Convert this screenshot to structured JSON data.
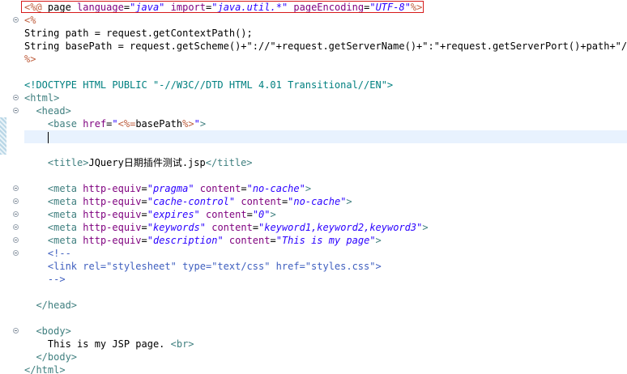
{
  "editor": {
    "lines": [
      [
        {
          "c": "jsp",
          "t": "<%@ "
        },
        {
          "c": "plain",
          "t": "page "
        },
        {
          "c": "attr",
          "t": "language"
        },
        {
          "c": "plain",
          "t": "="
        },
        {
          "c": "str",
          "t": "\"java\""
        },
        {
          "c": "plain",
          "t": " "
        },
        {
          "c": "attr",
          "t": "import"
        },
        {
          "c": "plain",
          "t": "="
        },
        {
          "c": "str",
          "t": "\"java.util.*\""
        },
        {
          "c": "plain",
          "t": " "
        },
        {
          "c": "attr",
          "t": "pageEncoding"
        },
        {
          "c": "plain",
          "t": "="
        },
        {
          "c": "str",
          "t": "\"UTF-8\""
        },
        {
          "c": "jsp",
          "t": "%>"
        }
      ],
      [
        {
          "c": "jsp",
          "t": "<%"
        }
      ],
      [
        {
          "c": "plain",
          "t": "String path = request.getContextPath();"
        }
      ],
      [
        {
          "c": "plain",
          "t": "String basePath = request.getScheme()+\"://\"+request.getServerName()+\":\"+request.getServerPort()+path+\"/\";"
        }
      ],
      [
        {
          "c": "jsp",
          "t": "%>"
        }
      ],
      [],
      [
        {
          "c": "doctype",
          "t": "<!DOCTYPE HTML PUBLIC \"-//W3C//DTD HTML 4.01 Transitional//EN\">"
        }
      ],
      [
        {
          "c": "tag",
          "t": "<html>"
        }
      ],
      [
        {
          "c": "plain",
          "t": "  "
        },
        {
          "c": "tag",
          "t": "<head>"
        }
      ],
      [
        {
          "c": "plain",
          "t": "    "
        },
        {
          "c": "tag",
          "t": "<base "
        },
        {
          "c": "attr",
          "t": "href"
        },
        {
          "c": "plain",
          "t": "="
        },
        {
          "c": "val",
          "t": "\""
        },
        {
          "c": "jsp",
          "t": "<%="
        },
        {
          "c": "plain",
          "t": "basePath"
        },
        {
          "c": "jsp",
          "t": "%>"
        },
        {
          "c": "val",
          "t": "\""
        },
        {
          "c": "tag",
          "t": ">"
        }
      ],
      [],
      [],
      [
        {
          "c": "plain",
          "t": "    "
        },
        {
          "c": "tag",
          "t": "<title>"
        },
        {
          "c": "text",
          "t": "JQuery日期插件测试.jsp"
        },
        {
          "c": "tag",
          "t": "</title>"
        }
      ],
      [],
      [
        {
          "c": "plain",
          "t": "    "
        },
        {
          "c": "tag",
          "t": "<meta "
        },
        {
          "c": "attr",
          "t": "http-equiv"
        },
        {
          "c": "plain",
          "t": "="
        },
        {
          "c": "str",
          "t": "\"pragma\""
        },
        {
          "c": "plain",
          "t": " "
        },
        {
          "c": "attr",
          "t": "content"
        },
        {
          "c": "plain",
          "t": "="
        },
        {
          "c": "str",
          "t": "\"no-cache\""
        },
        {
          "c": "tag",
          "t": ">"
        }
      ],
      [
        {
          "c": "plain",
          "t": "    "
        },
        {
          "c": "tag",
          "t": "<meta "
        },
        {
          "c": "attr",
          "t": "http-equiv"
        },
        {
          "c": "plain",
          "t": "="
        },
        {
          "c": "str",
          "t": "\"cache-control\""
        },
        {
          "c": "plain",
          "t": " "
        },
        {
          "c": "attr",
          "t": "content"
        },
        {
          "c": "plain",
          "t": "="
        },
        {
          "c": "str",
          "t": "\"no-cache\""
        },
        {
          "c": "tag",
          "t": ">"
        }
      ],
      [
        {
          "c": "plain",
          "t": "    "
        },
        {
          "c": "tag",
          "t": "<meta "
        },
        {
          "c": "attr",
          "t": "http-equiv"
        },
        {
          "c": "plain",
          "t": "="
        },
        {
          "c": "str",
          "t": "\"expires\""
        },
        {
          "c": "plain",
          "t": " "
        },
        {
          "c": "attr",
          "t": "content"
        },
        {
          "c": "plain",
          "t": "="
        },
        {
          "c": "str",
          "t": "\"0\""
        },
        {
          "c": "tag",
          "t": ">"
        }
      ],
      [
        {
          "c": "plain",
          "t": "    "
        },
        {
          "c": "tag",
          "t": "<meta "
        },
        {
          "c": "attr",
          "t": "http-equiv"
        },
        {
          "c": "plain",
          "t": "="
        },
        {
          "c": "str",
          "t": "\"keywords\""
        },
        {
          "c": "plain",
          "t": " "
        },
        {
          "c": "attr",
          "t": "content"
        },
        {
          "c": "plain",
          "t": "="
        },
        {
          "c": "str",
          "t": "\"keyword1,keyword2,keyword3\""
        },
        {
          "c": "tag",
          "t": ">"
        }
      ],
      [
        {
          "c": "plain",
          "t": "    "
        },
        {
          "c": "tag",
          "t": "<meta "
        },
        {
          "c": "attr",
          "t": "http-equiv"
        },
        {
          "c": "plain",
          "t": "="
        },
        {
          "c": "str",
          "t": "\"description\""
        },
        {
          "c": "plain",
          "t": " "
        },
        {
          "c": "attr",
          "t": "content"
        },
        {
          "c": "plain",
          "t": "="
        },
        {
          "c": "str",
          "t": "\"This is my page\""
        },
        {
          "c": "tag",
          "t": ">"
        }
      ],
      [
        {
          "c": "plain",
          "t": "    "
        },
        {
          "c": "cmt",
          "t": "<!--"
        }
      ],
      [
        {
          "c": "plain",
          "t": "    "
        },
        {
          "c": "cmt",
          "t": "<link rel=\"stylesheet\" type=\"text/css\" href=\"styles.css\">"
        }
      ],
      [
        {
          "c": "plain",
          "t": "    "
        },
        {
          "c": "cmt",
          "t": "-->"
        }
      ],
      [],
      [
        {
          "c": "plain",
          "t": "  "
        },
        {
          "c": "tag",
          "t": "</head>"
        }
      ],
      [],
      [
        {
          "c": "plain",
          "t": "  "
        },
        {
          "c": "tag",
          "t": "<body>"
        }
      ],
      [
        {
          "c": "plain",
          "t": "    "
        },
        {
          "c": "text",
          "t": "This is my JSP page. "
        },
        {
          "c": "tag",
          "t": "<br>"
        }
      ],
      [
        {
          "c": "plain",
          "t": "  "
        },
        {
          "c": "tag",
          "t": "</body>"
        }
      ],
      [
        {
          "c": "tag",
          "t": "</html>"
        }
      ]
    ],
    "current_line": 10,
    "fold_icons": [
      1,
      7,
      8,
      14,
      15,
      16,
      17,
      18,
      19,
      25
    ]
  },
  "colors": {
    "tag": "#3f7f7f",
    "attribute": "#7f007f",
    "string": "#2a00ff",
    "jsp_delimiter": "#bf5f3f",
    "comment": "#3f5fbf",
    "current_line": "#e8f2fe",
    "highlight_box": "#d61a1a"
  }
}
